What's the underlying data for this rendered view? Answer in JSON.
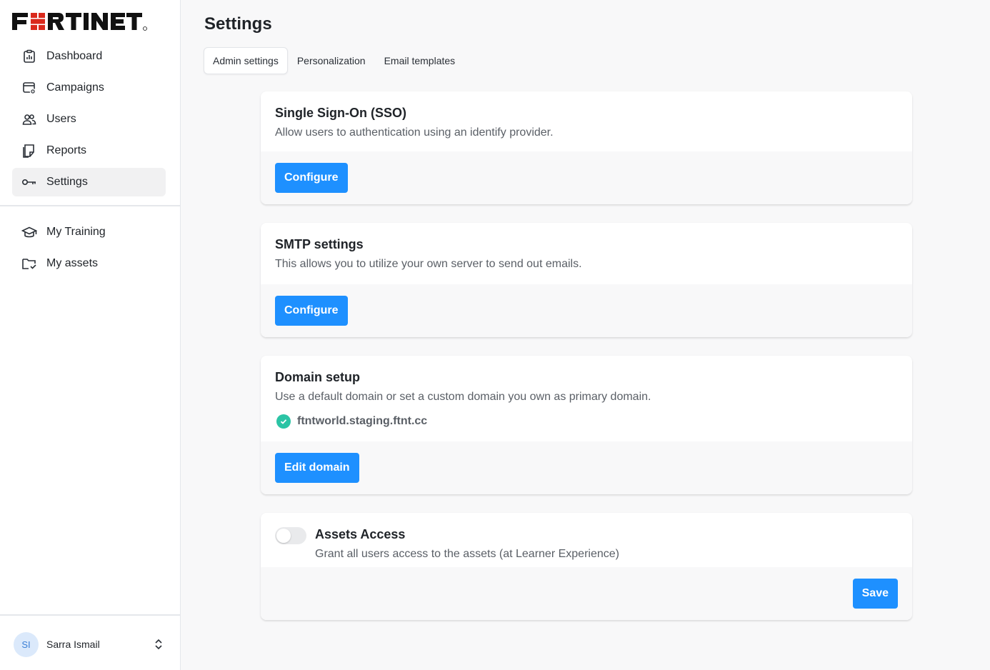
{
  "brand": {
    "logo_text": "FURTINET",
    "accent_color": "#1e90ff",
    "logo_red": "#da291c"
  },
  "sidebar": {
    "main_items": [
      {
        "label": "Dashboard",
        "icon": "dashboard-icon"
      },
      {
        "label": "Campaigns",
        "icon": "campaigns-icon"
      },
      {
        "label": "Users",
        "icon": "users-icon"
      },
      {
        "label": "Reports",
        "icon": "reports-icon"
      },
      {
        "label": "Settings",
        "icon": "settings-icon",
        "active": true
      }
    ],
    "secondary_items": [
      {
        "label": "My Training",
        "icon": "graduation-cap-icon"
      },
      {
        "label": "My assets",
        "icon": "folder-check-icon"
      }
    ],
    "user": {
      "initials": "SI",
      "name": "Sarra Ismail"
    }
  },
  "main": {
    "title": "Settings",
    "tabs": [
      {
        "label": "Admin settings",
        "active": true
      },
      {
        "label": "Personalization"
      },
      {
        "label": "Email templates"
      }
    ],
    "sso": {
      "title": "Single Sign-On (SSO)",
      "description": "Allow users to authentication using an identify provider.",
      "button": "Configure"
    },
    "smtp": {
      "title": "SMTP settings",
      "description": "This allows you to utilize your own server to send out emails.",
      "button": "Configure"
    },
    "domain": {
      "title": "Domain setup",
      "description": "Use a default domain or set a custom domain you own as primary domain.",
      "domain_value": "ftntworld.staging.ftnt.cc",
      "button": "Edit domain"
    },
    "assets": {
      "title": "Assets Access",
      "description": "Grant all users access to the assets (at Learner Experience)",
      "toggle_on": false,
      "button": "Save"
    }
  }
}
